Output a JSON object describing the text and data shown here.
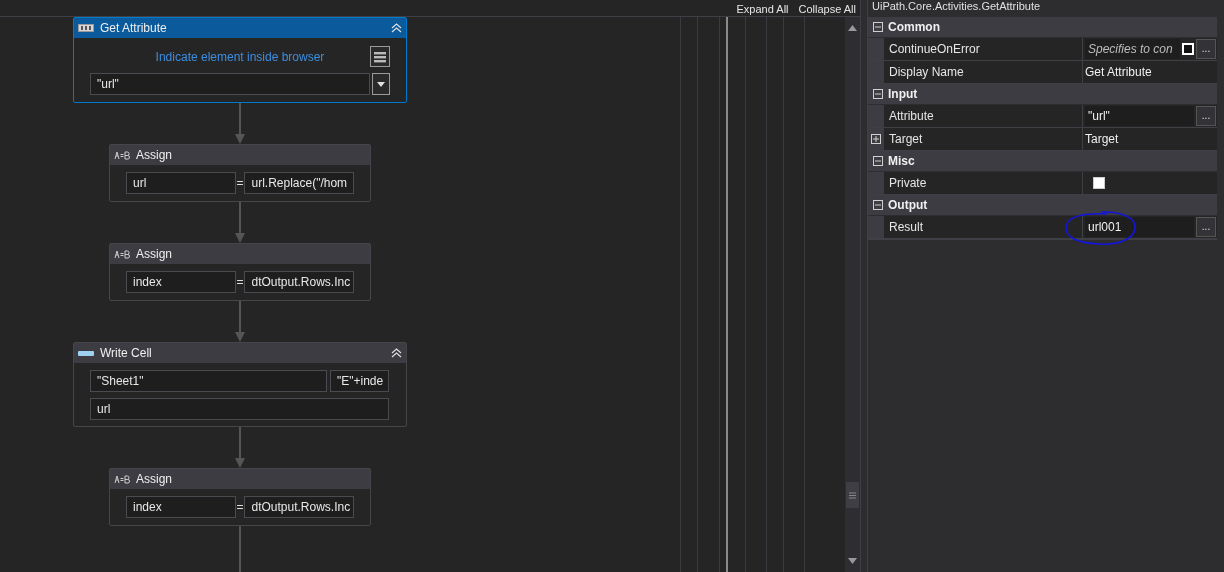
{
  "canvas_toolbar": {
    "expand_all": "Expand All",
    "collapse_all": "Collapse All"
  },
  "activities": [
    {
      "kind": "get_attribute",
      "title": "Get Attribute",
      "selected": true,
      "hint": "Indicate element inside browser",
      "value": "\"url\""
    },
    {
      "kind": "assign",
      "title": "Assign",
      "selected": false,
      "to": "url",
      "operator": "=",
      "value": "url.Replace(\"/hom"
    },
    {
      "kind": "assign",
      "title": "Assign",
      "selected": false,
      "to": "index",
      "operator": "=",
      "value": "dtOutput.Rows.Inc"
    },
    {
      "kind": "write_cell",
      "title": "Write Cell",
      "selected": false,
      "sheet": "\"Sheet1\"",
      "cell": "\"E\"+inde",
      "value": "url"
    },
    {
      "kind": "assign",
      "title": "Assign",
      "selected": false,
      "to": "index",
      "operator": "=",
      "value": "dtOutput.Rows.Inc"
    }
  ],
  "properties": {
    "title": "UiPath.Core.Activities.GetAttribute",
    "categories": [
      {
        "name": "Common",
        "expanded": true,
        "rows": [
          {
            "kind": "expression_checkbox",
            "name": "ContinueOnError",
            "placeholder": "Specifies to con",
            "checked": false,
            "button": "..."
          },
          {
            "kind": "text",
            "name": "Display Name",
            "value": "Get Attribute"
          }
        ]
      },
      {
        "name": "Input",
        "expanded": true,
        "rows": [
          {
            "kind": "expression",
            "name": "Attribute",
            "value": "\"url\"",
            "button": "..."
          },
          {
            "kind": "expandable",
            "name": "Target",
            "value": "Target",
            "expanded": false
          }
        ]
      },
      {
        "name": "Misc",
        "expanded": true,
        "rows": [
          {
            "kind": "checkbox",
            "name": "Private",
            "checked": false
          }
        ]
      },
      {
        "name": "Output",
        "expanded": true,
        "rows": [
          {
            "kind": "expression",
            "name": "Result",
            "value": "url001",
            "button": "...",
            "annotated": true
          }
        ]
      }
    ]
  }
}
